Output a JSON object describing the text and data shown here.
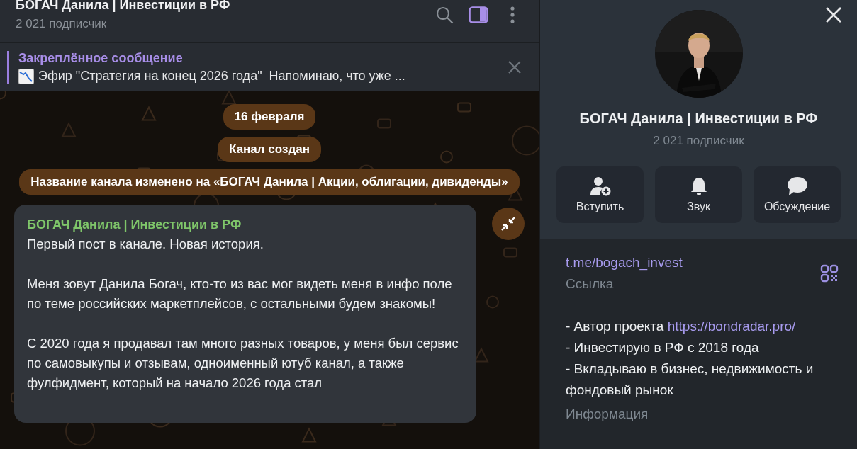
{
  "header": {
    "title": "БОГАЧ Данила | Инвестиции в РФ",
    "subtitle": "2 021 подписчик",
    "tools": [
      {
        "kind": "search"
      },
      {
        "kind": "panel"
      },
      {
        "kind": "more"
      }
    ]
  },
  "pinned": {
    "label": "Закреплённое сообщение",
    "text": "Эфир \"Стратегия на конец 2026 года\"  Напоминаю, что уже ..."
  },
  "service_messages": [
    "16 февраля",
    "Канал создан",
    "Название канала изменено на «БОГАЧ Данила | Акции, облигации, дивиденды»"
  ],
  "post": {
    "author": "БОГАЧ Данила | Инвестиции в РФ",
    "paragraphs": [
      "Первый пост в канале. Новая история.",
      "Меня зовут Данила Богач, кто-то из вас мог видеть меня в инфо поле по теме российских маркетплейсов, с остальными будем знакомы!",
      "С 2020 года я продавал там много разных товаров, у меня был сервис по самовыкупы и отзывам, одноименный ютуб канал, а также фулфидмент, который на начало 2026 года стал"
    ]
  },
  "profile": {
    "name": "БОГАЧ Данила | Инвестиции в РФ",
    "subtitle": "2 021 подписчик",
    "actions": [
      {
        "kind": "join",
        "label": "Вступить"
      },
      {
        "kind": "sound",
        "label": "Звук"
      },
      {
        "kind": "discussion",
        "label": "Обсуждение"
      }
    ],
    "link": "t.me/bogach_invest",
    "link_label": "Ссылка",
    "about": [
      {
        "text": "- Автор проекта",
        "link": "https://bondradar.pro/"
      },
      {
        "text": "- Инвестирую в РФ с 2018 года"
      },
      {
        "text": "- Вкладываю в бизнес, недвижимость и фондовый рынок"
      }
    ],
    "about_label": "Информация"
  }
}
